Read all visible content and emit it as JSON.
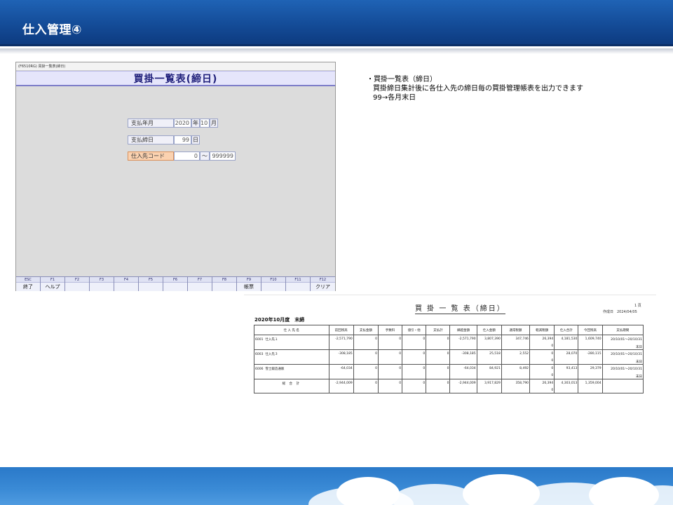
{
  "slide": {
    "title": "仕入管理④"
  },
  "app": {
    "caption": "(F6510RG) 買掛一覧表(締日)",
    "header": "買掛一覧表(締日)",
    "fields": {
      "pay_year_month": {
        "label": "支払年月",
        "year": "2020",
        "year_unit": "年",
        "month": "10",
        "month_unit": "月"
      },
      "pay_close_day": {
        "label": "支払締日",
        "value": "99",
        "unit": "日"
      },
      "supplier_code": {
        "label": "仕入先コード",
        "from": "0",
        "separator": "～",
        "to": "999999"
      }
    },
    "function_keys": [
      {
        "key": "ESC",
        "label": "終了"
      },
      {
        "key": "F1",
        "label": "ヘルプ"
      },
      {
        "key": "F2",
        "label": ""
      },
      {
        "key": "F3",
        "label": ""
      },
      {
        "key": "F4",
        "label": ""
      },
      {
        "key": "F5",
        "label": ""
      },
      {
        "key": "F6",
        "label": ""
      },
      {
        "key": "F7",
        "label": ""
      },
      {
        "key": "F8",
        "label": ""
      },
      {
        "key": "F9",
        "label": "帳票"
      },
      {
        "key": "F10",
        "label": ""
      },
      {
        "key": "F11",
        "label": ""
      },
      {
        "key": "F12",
        "label": "クリア"
      }
    ]
  },
  "description": {
    "line1": "・買掛一覧表（締日）",
    "line2": "買掛締日集計後に各仕入先の締日毎の買掛管理帳表を出力できます",
    "line3": "99→各月末日"
  },
  "report": {
    "title": "買 掛 一 覧 表（締日）",
    "page": "1 頁",
    "created": "作成日　2024/04/05",
    "period": "2020年10月度　末締",
    "columns": [
      "仕 入 先 名",
      "前回残高",
      "支払金額",
      "手数料",
      "値引・他",
      "支払計",
      "繰越金額",
      "仕入金額",
      "通常税額",
      "軽減税額",
      "仕入合計",
      "今回残高",
      "支払期間"
    ],
    "rows": [
      {
        "code": "6001",
        "name": "仕入先１",
        "prev": "-2,571,790",
        "pay": "0",
        "fee": "0",
        "disc": "0",
        "paytotal": "0",
        "carry": "-2,571,790",
        "purchase": "3,807,390",
        "tax": "347,746",
        "reduced": "26,394",
        "reduced2": "0",
        "total": "4,181,530",
        "balance": "1,609,740",
        "range": "20/10/01～20/10/31",
        "range2": "末日"
      },
      {
        "code": "6003",
        "name": "仕入先３",
        "prev": "-308,185",
        "pay": "0",
        "fee": "0",
        "disc": "0",
        "paytotal": "0",
        "carry": "-308,185",
        "purchase": "25,518",
        "tax": "2,552",
        "reduced": "0",
        "reduced2": "0",
        "total": "28,070",
        "balance": "-280,115",
        "range": "20/10/01～20/10/31",
        "range2": "末日"
      },
      {
        "code": "6006",
        "name": "雪士鍛造通販",
        "prev": "-64,034",
        "pay": "0",
        "fee": "0",
        "disc": "0",
        "paytotal": "0",
        "carry": "-64,034",
        "purchase": "84,921",
        "tax": "8,492",
        "reduced": "0",
        "reduced2": "0",
        "total": "93,413",
        "balance": "29,379",
        "range": "20/10/01～20/10/31",
        "range2": "末日"
      }
    ],
    "grand_total": {
      "label": "総 合 計",
      "prev": "-2,944,009",
      "pay": "0",
      "fee": "0",
      "disc": "0",
      "paytotal": "0",
      "carry": "-2,944,009",
      "purchase": "3,917,829",
      "tax": "358,790",
      "reduced": "26,394",
      "reduced2": "0",
      "total": "4,303,013",
      "balance": "1,359,004"
    }
  }
}
